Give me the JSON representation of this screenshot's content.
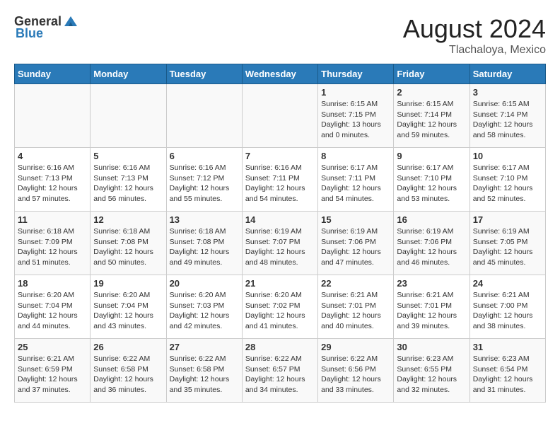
{
  "header": {
    "logo_general": "General",
    "logo_blue": "Blue",
    "title": "August 2024",
    "subtitle": "Tlachaloya, Mexico"
  },
  "weekdays": [
    "Sunday",
    "Monday",
    "Tuesday",
    "Wednesday",
    "Thursday",
    "Friday",
    "Saturday"
  ],
  "weeks": [
    [
      {
        "day": "",
        "sunrise": "",
        "sunset": "",
        "daylight": ""
      },
      {
        "day": "",
        "sunrise": "",
        "sunset": "",
        "daylight": ""
      },
      {
        "day": "",
        "sunrise": "",
        "sunset": "",
        "daylight": ""
      },
      {
        "day": "",
        "sunrise": "",
        "sunset": "",
        "daylight": ""
      },
      {
        "day": "1",
        "sunrise": "Sunrise: 6:15 AM",
        "sunset": "Sunset: 7:15 PM",
        "daylight": "Daylight: 13 hours and 0 minutes."
      },
      {
        "day": "2",
        "sunrise": "Sunrise: 6:15 AM",
        "sunset": "Sunset: 7:14 PM",
        "daylight": "Daylight: 12 hours and 59 minutes."
      },
      {
        "day": "3",
        "sunrise": "Sunrise: 6:15 AM",
        "sunset": "Sunset: 7:14 PM",
        "daylight": "Daylight: 12 hours and 58 minutes."
      }
    ],
    [
      {
        "day": "4",
        "sunrise": "Sunrise: 6:16 AM",
        "sunset": "Sunset: 7:13 PM",
        "daylight": "Daylight: 12 hours and 57 minutes."
      },
      {
        "day": "5",
        "sunrise": "Sunrise: 6:16 AM",
        "sunset": "Sunset: 7:13 PM",
        "daylight": "Daylight: 12 hours and 56 minutes."
      },
      {
        "day": "6",
        "sunrise": "Sunrise: 6:16 AM",
        "sunset": "Sunset: 7:12 PM",
        "daylight": "Daylight: 12 hours and 55 minutes."
      },
      {
        "day": "7",
        "sunrise": "Sunrise: 6:16 AM",
        "sunset": "Sunset: 7:11 PM",
        "daylight": "Daylight: 12 hours and 54 minutes."
      },
      {
        "day": "8",
        "sunrise": "Sunrise: 6:17 AM",
        "sunset": "Sunset: 7:11 PM",
        "daylight": "Daylight: 12 hours and 54 minutes."
      },
      {
        "day": "9",
        "sunrise": "Sunrise: 6:17 AM",
        "sunset": "Sunset: 7:10 PM",
        "daylight": "Daylight: 12 hours and 53 minutes."
      },
      {
        "day": "10",
        "sunrise": "Sunrise: 6:17 AM",
        "sunset": "Sunset: 7:10 PM",
        "daylight": "Daylight: 12 hours and 52 minutes."
      }
    ],
    [
      {
        "day": "11",
        "sunrise": "Sunrise: 6:18 AM",
        "sunset": "Sunset: 7:09 PM",
        "daylight": "Daylight: 12 hours and 51 minutes."
      },
      {
        "day": "12",
        "sunrise": "Sunrise: 6:18 AM",
        "sunset": "Sunset: 7:08 PM",
        "daylight": "Daylight: 12 hours and 50 minutes."
      },
      {
        "day": "13",
        "sunrise": "Sunrise: 6:18 AM",
        "sunset": "Sunset: 7:08 PM",
        "daylight": "Daylight: 12 hours and 49 minutes."
      },
      {
        "day": "14",
        "sunrise": "Sunrise: 6:19 AM",
        "sunset": "Sunset: 7:07 PM",
        "daylight": "Daylight: 12 hours and 48 minutes."
      },
      {
        "day": "15",
        "sunrise": "Sunrise: 6:19 AM",
        "sunset": "Sunset: 7:06 PM",
        "daylight": "Daylight: 12 hours and 47 minutes."
      },
      {
        "day": "16",
        "sunrise": "Sunrise: 6:19 AM",
        "sunset": "Sunset: 7:06 PM",
        "daylight": "Daylight: 12 hours and 46 minutes."
      },
      {
        "day": "17",
        "sunrise": "Sunrise: 6:19 AM",
        "sunset": "Sunset: 7:05 PM",
        "daylight": "Daylight: 12 hours and 45 minutes."
      }
    ],
    [
      {
        "day": "18",
        "sunrise": "Sunrise: 6:20 AM",
        "sunset": "Sunset: 7:04 PM",
        "daylight": "Daylight: 12 hours and 44 minutes."
      },
      {
        "day": "19",
        "sunrise": "Sunrise: 6:20 AM",
        "sunset": "Sunset: 7:04 PM",
        "daylight": "Daylight: 12 hours and 43 minutes."
      },
      {
        "day": "20",
        "sunrise": "Sunrise: 6:20 AM",
        "sunset": "Sunset: 7:03 PM",
        "daylight": "Daylight: 12 hours and 42 minutes."
      },
      {
        "day": "21",
        "sunrise": "Sunrise: 6:20 AM",
        "sunset": "Sunset: 7:02 PM",
        "daylight": "Daylight: 12 hours and 41 minutes."
      },
      {
        "day": "22",
        "sunrise": "Sunrise: 6:21 AM",
        "sunset": "Sunset: 7:01 PM",
        "daylight": "Daylight: 12 hours and 40 minutes."
      },
      {
        "day": "23",
        "sunrise": "Sunrise: 6:21 AM",
        "sunset": "Sunset: 7:01 PM",
        "daylight": "Daylight: 12 hours and 39 minutes."
      },
      {
        "day": "24",
        "sunrise": "Sunrise: 6:21 AM",
        "sunset": "Sunset: 7:00 PM",
        "daylight": "Daylight: 12 hours and 38 minutes."
      }
    ],
    [
      {
        "day": "25",
        "sunrise": "Sunrise: 6:21 AM",
        "sunset": "Sunset: 6:59 PM",
        "daylight": "Daylight: 12 hours and 37 minutes."
      },
      {
        "day": "26",
        "sunrise": "Sunrise: 6:22 AM",
        "sunset": "Sunset: 6:58 PM",
        "daylight": "Daylight: 12 hours and 36 minutes."
      },
      {
        "day": "27",
        "sunrise": "Sunrise: 6:22 AM",
        "sunset": "Sunset: 6:58 PM",
        "daylight": "Daylight: 12 hours and 35 minutes."
      },
      {
        "day": "28",
        "sunrise": "Sunrise: 6:22 AM",
        "sunset": "Sunset: 6:57 PM",
        "daylight": "Daylight: 12 hours and 34 minutes."
      },
      {
        "day": "29",
        "sunrise": "Sunrise: 6:22 AM",
        "sunset": "Sunset: 6:56 PM",
        "daylight": "Daylight: 12 hours and 33 minutes."
      },
      {
        "day": "30",
        "sunrise": "Sunrise: 6:23 AM",
        "sunset": "Sunset: 6:55 PM",
        "daylight": "Daylight: 12 hours and 32 minutes."
      },
      {
        "day": "31",
        "sunrise": "Sunrise: 6:23 AM",
        "sunset": "Sunset: 6:54 PM",
        "daylight": "Daylight: 12 hours and 31 minutes."
      }
    ]
  ]
}
